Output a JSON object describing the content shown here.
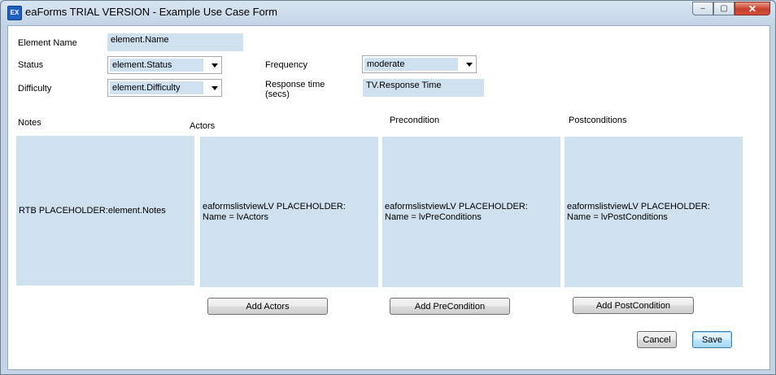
{
  "window": {
    "icon_text": "EX",
    "title": "eaForms TRIAL VERSION - Example Use Case Form",
    "minimize_glyph": "‒",
    "maximize_glyph": "▢",
    "close_glyph": "✕"
  },
  "form": {
    "element_name": {
      "label": "Element Name",
      "value": "element.Name"
    },
    "status": {
      "label": "Status",
      "value": "element.Status"
    },
    "difficulty": {
      "label": "Difficulty",
      "value": "element.Difficulty"
    },
    "frequency": {
      "label": "Frequency",
      "value": "moderate"
    },
    "response_time": {
      "label_line1": "Response time",
      "label_line2": "(secs)",
      "value": "TV.Response Time"
    }
  },
  "sections": {
    "notes": {
      "label": "Notes",
      "placeholder": "RTB PLACEHOLDER:element.Notes"
    },
    "actors": {
      "label": "Actors",
      "line1": "eaformslistviewLV PLACEHOLDER:",
      "line2": "Name = lvActors",
      "button": "Add Actors"
    },
    "precondition": {
      "label": "Precondition",
      "line1": "eaformslistviewLV PLACEHOLDER:",
      "line2": "Name = lvPreConditions",
      "button": "Add PreCondition"
    },
    "postconditions": {
      "label": "Postconditions",
      "line1": "eaformslistviewLV PLACEHOLDER:",
      "line2": "Name = lvPostConditions",
      "button": "Add PostCondition"
    }
  },
  "footer": {
    "cancel_label": "Cancel",
    "save_label": "Save"
  }
}
